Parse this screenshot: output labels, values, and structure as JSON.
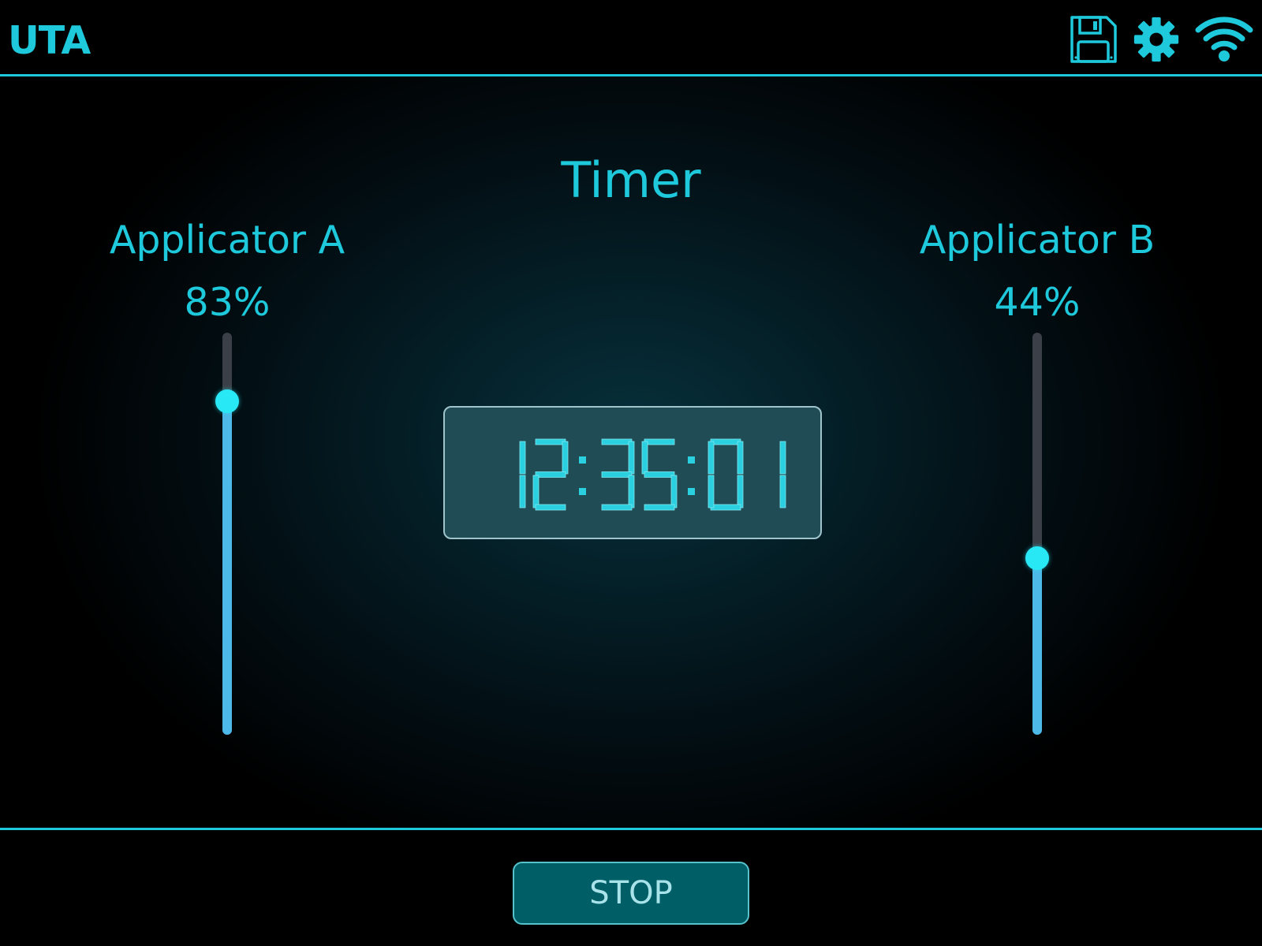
{
  "header": {
    "title": "UTA",
    "icons": [
      "save-icon",
      "gear-icon",
      "wifi-icon"
    ]
  },
  "main": {
    "timer_title": "Timer",
    "timer_value": "12:35:01",
    "applicator_a": {
      "label": "Applicator A",
      "value_text": "83%",
      "level": 0.83
    },
    "applicator_b": {
      "label": "Applicator B",
      "value_text": "44%",
      "level": 0.44
    }
  },
  "footer": {
    "stop_label": "STOP"
  },
  "colors": {
    "accent": "#1ec9dc",
    "slider_fill": "#4db9e8",
    "slider_track": "#3b3f47",
    "slider_thumb": "#29e8f5",
    "display_bg": "#204c56",
    "button_bg": "#005e67"
  }
}
